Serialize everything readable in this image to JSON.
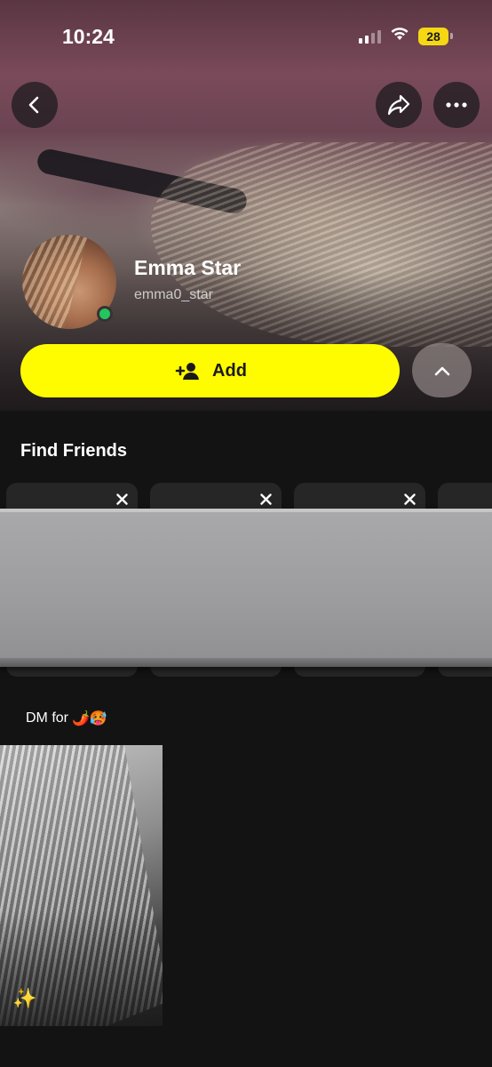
{
  "status_bar": {
    "time": "10:24",
    "battery_level": "28",
    "battery_color": "#f6d713"
  },
  "header": {
    "back_icon": "chevron-left-icon",
    "share_icon": "share-arrow-icon",
    "more_icon": "more-horizontal-icon"
  },
  "profile": {
    "display_name": "Emma Star",
    "username": "emma0_star",
    "online": true,
    "online_color": "#22c55e"
  },
  "actions": {
    "add_label": "Add",
    "add_icon": "add-friend-icon",
    "add_color": "#fffc00",
    "collapse_icon": "chevron-up-icon"
  },
  "find_friends": {
    "title": "Find Friends",
    "close_icon": "close-icon"
  },
  "story": {
    "label": "DM for",
    "label_emojis": "🌶️🥵",
    "thumbnail_emoji": "✨"
  }
}
